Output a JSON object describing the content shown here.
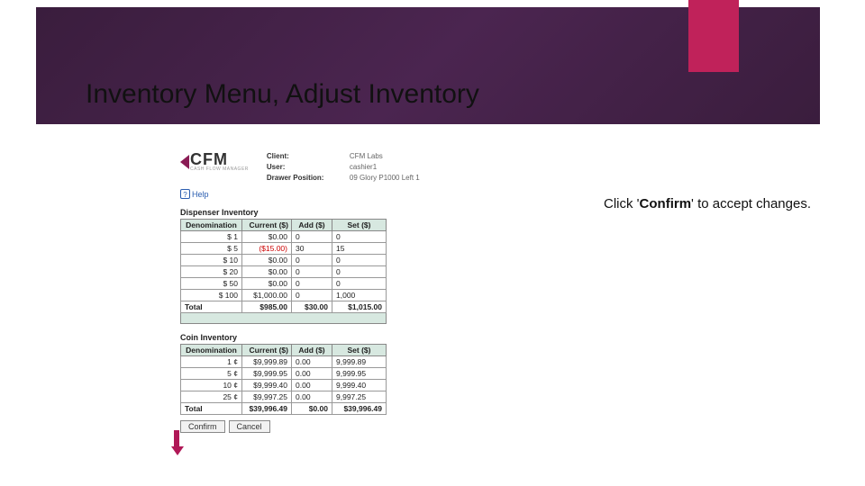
{
  "slide": {
    "title": "Inventory Menu, Adjust Inventory"
  },
  "instruction": {
    "pre": "Click '",
    "bold": "Confirm",
    "post": "' to accept changes."
  },
  "app": {
    "logo": {
      "text": "CFM",
      "subtitle": "CASH FLOW MANAGER"
    },
    "meta": {
      "client_label": "Client:",
      "client": "CFM Labs",
      "user_label": "User:",
      "user": "cashier1",
      "drawer_label": "Drawer Position:",
      "drawer": "09 Glory P1000 Left 1"
    },
    "help": "Help"
  },
  "dispenser": {
    "title": "Dispenser Inventory",
    "headers": [
      "Denomination",
      "Current ($)",
      "Add ($)",
      "Set ($)"
    ],
    "rows": [
      {
        "den": "$_1",
        "cur": "$0.00",
        "add": "0",
        "set": "0"
      },
      {
        "den": "$_5",
        "cur": "($15.00)",
        "add": "30",
        "set": "15",
        "neg": true
      },
      {
        "den": "$_10",
        "cur": "$0.00",
        "add": "0",
        "set": "0"
      },
      {
        "den": "$_20",
        "cur": "$0.00",
        "add": "0",
        "set": "0"
      },
      {
        "den": "$_50",
        "cur": "$0.00",
        "add": "0",
        "set": "0"
      },
      {
        "den": "$_100",
        "cur": "$1,000.00",
        "add": "0",
        "set": "1,000"
      }
    ],
    "total": {
      "label": "Total",
      "cur": "$985.00",
      "add": "$30.00",
      "set": "$1,015.00"
    }
  },
  "coin": {
    "title": "Coin Inventory",
    "headers": [
      "Denomination",
      "Current ($)",
      "Add ($)",
      "Set ($)"
    ],
    "rows": [
      {
        "den": "1 ¢",
        "cur": "$9,999.89",
        "add": "0.00",
        "set": "9,999.89"
      },
      {
        "den": "5 ¢",
        "cur": "$9,999.95",
        "add": "0.00",
        "set": "9,999.95"
      },
      {
        "den": "10 ¢",
        "cur": "$9,999.40",
        "add": "0.00",
        "set": "9,999.40"
      },
      {
        "den": "25 ¢",
        "cur": "$9,997.25",
        "add": "0.00",
        "set": "9,997.25"
      }
    ],
    "total": {
      "label": "Total",
      "cur": "$39,996.49",
      "add": "$0.00",
      "set": "$39,996.49"
    }
  },
  "buttons": {
    "confirm": "Confirm",
    "cancel": "Cancel"
  }
}
